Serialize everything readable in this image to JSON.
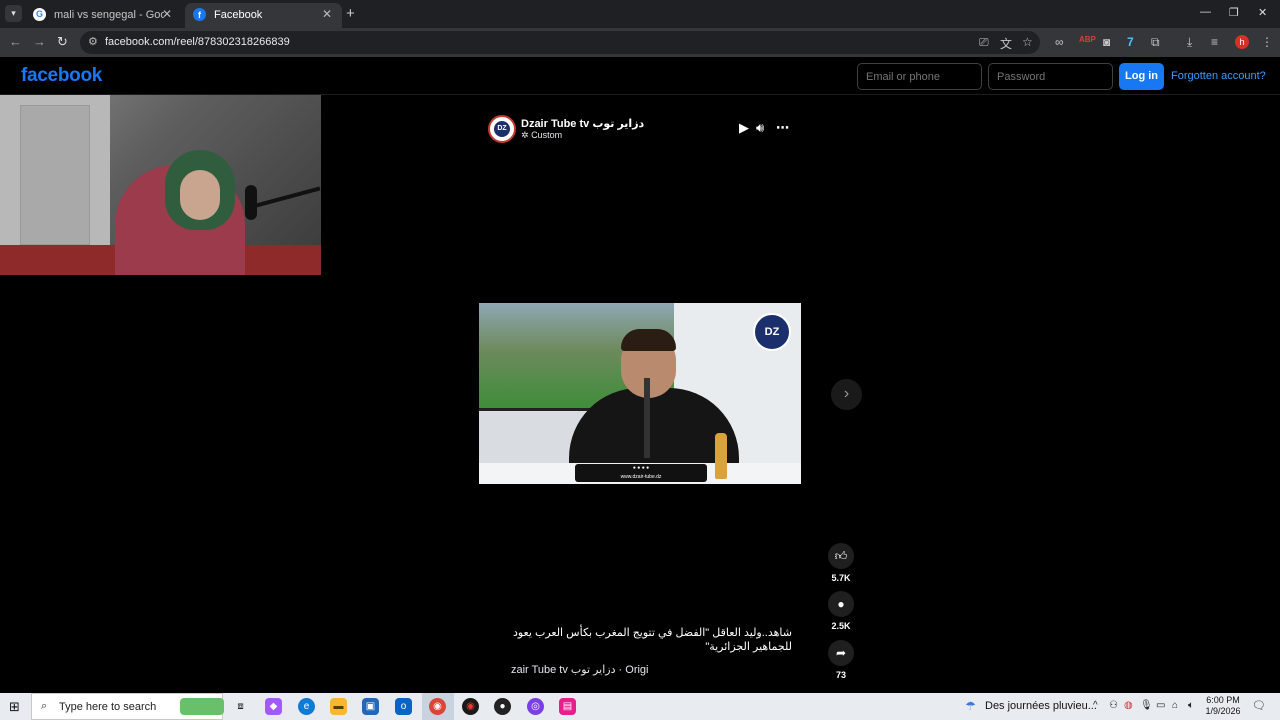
{
  "browser": {
    "tabs": [
      {
        "title": "mali vs sengegal - Google Search",
        "favicon": "G"
      },
      {
        "title": "Facebook",
        "favicon": "f"
      }
    ],
    "url": "facebook.com/reel/878302318266839",
    "profile_initial": "h"
  },
  "facebook": {
    "logo": "facebook",
    "email_placeholder": "Email or phone",
    "password_placeholder": "Password",
    "login_label": "Log in",
    "forgot_label": "Forgotten account?"
  },
  "reel": {
    "channel_name": "Dzair Tube tv دزاير توب",
    "audience": "Custom",
    "video_watermark": "www.dzair-tube.dz",
    "likes": "5.7K",
    "comments": "2.5K",
    "shares": "73",
    "caption": "شاهد..وليد العاقل \"الفضل في تتويج المغرب بكأس العرب يعود للجماهير الجزائرية\"",
    "caption_meta": "zair Tube tv دزاير توب · Origi"
  },
  "taskbar": {
    "search_placeholder": "Type here to search",
    "weather": "Des journées pluvieu...",
    "time": "6:00 PM",
    "date": "1/9/2026"
  }
}
